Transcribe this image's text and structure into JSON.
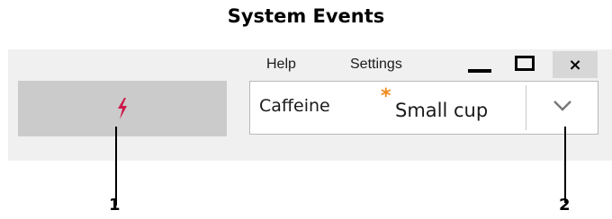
{
  "window": {
    "title": "System Events"
  },
  "menu": {
    "help": "Help",
    "settings": "Settings"
  },
  "controls": {
    "close_glyph": "×"
  },
  "caffeine_button": {
    "icon": "lightning-icon",
    "icon_color": "#cc1a4a"
  },
  "dropdown": {
    "label": "Caffeine",
    "marker": "*",
    "selected": "Small cup",
    "marker_color": "#f08a1d"
  },
  "callouts": {
    "one": "1",
    "two": "2"
  }
}
